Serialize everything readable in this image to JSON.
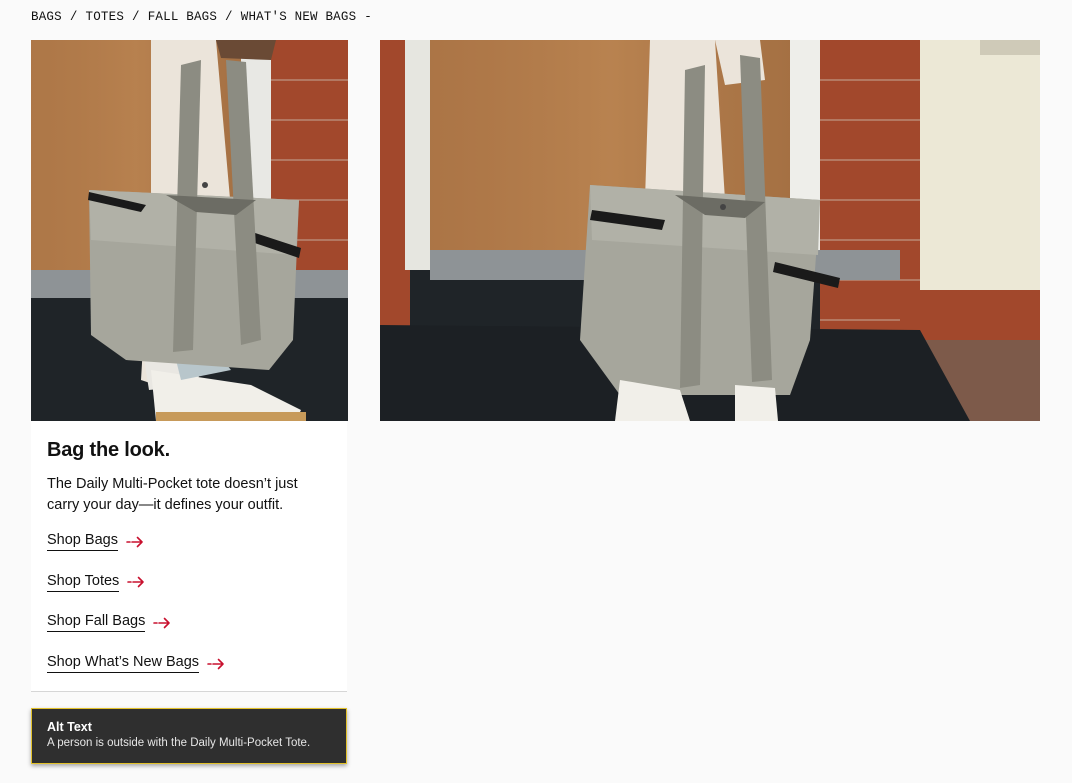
{
  "breadcrumb": {
    "items": [
      "BAGS",
      "TOTES",
      "FALL BAGS",
      "WHAT'S NEW BAGS"
    ],
    "separator": "/",
    "trailing": "-"
  },
  "card": {
    "heading": "Bag the look.",
    "body": "The Daily Multi-Pocket tote doesn’t just carry your day—it defines your outfit.",
    "links": [
      {
        "label": "Shop Bags"
      },
      {
        "label": "Shop Totes"
      },
      {
        "label": "Shop Fall Bags"
      },
      {
        "label": "Shop What’s New Bags"
      }
    ]
  },
  "alt_text": {
    "title": "Alt Text",
    "description": "A person is outside with the Daily Multi-Pocket Tote."
  },
  "colors": {
    "accent_arrow": "#c8102e",
    "alt_box_border": "#e2c12a",
    "alt_box_bg": "#2f2f2f"
  },
  "icons": {
    "link_arrow": "arrow-right-icon"
  }
}
